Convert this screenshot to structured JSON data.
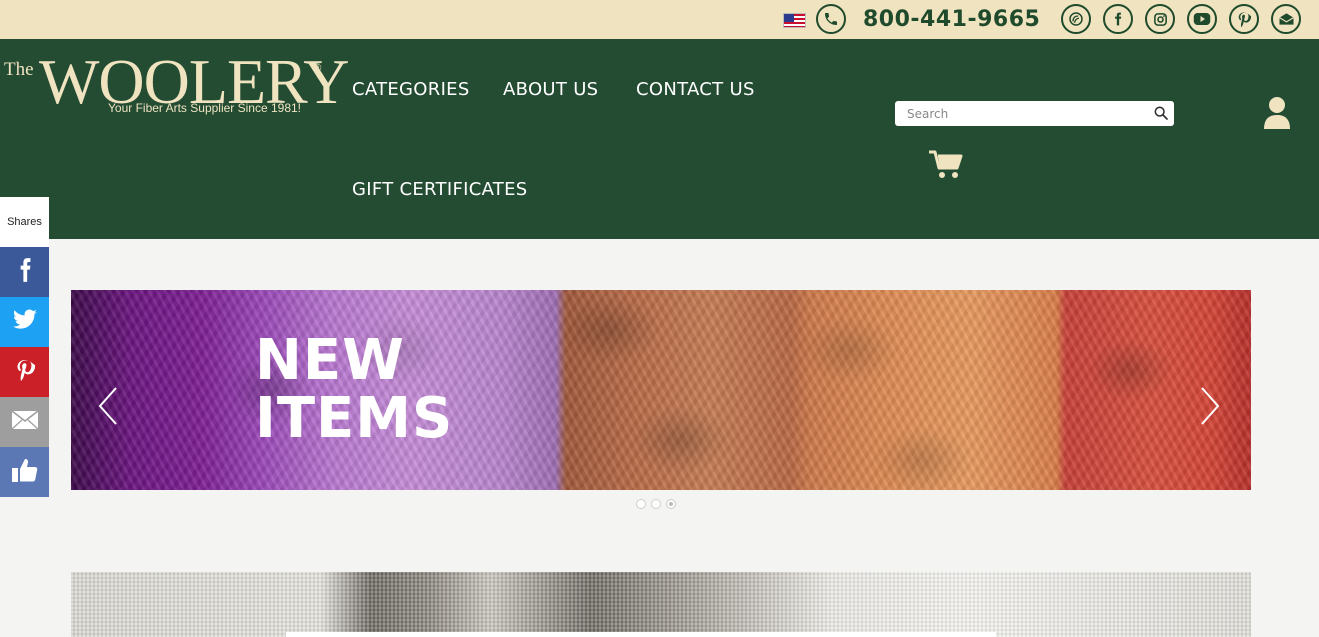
{
  "topbar": {
    "flag_icon": "us-flag-icon",
    "phone_number": "800-441-9665",
    "social_icons": [
      "ravelry-icon",
      "facebook-icon",
      "instagram-icon",
      "youtube-icon",
      "pinterest-icon",
      "email-icon"
    ],
    "background_color": "#efe3c0",
    "icon_color": "#1f4a2c"
  },
  "header": {
    "background_color": "#244c33",
    "logo": {
      "prefix": "The",
      "name": "WOOLERY",
      "registered": "®",
      "tagline": "Your Fiber Arts Supplier Since 1981!"
    },
    "nav": [
      {
        "label": "CATEGORIES"
      },
      {
        "label": "ABOUT US"
      },
      {
        "label": "CONTACT US"
      },
      {
        "label": "GIFT CERTIFICATES"
      }
    ],
    "search": {
      "placeholder": "Search",
      "value": ""
    },
    "cart_icon": "cart-icon",
    "account_icon": "user-icon"
  },
  "share_bar": {
    "label": "Shares",
    "buttons": [
      {
        "name": "facebook",
        "color": "#3b5998"
      },
      {
        "name": "twitter",
        "color": "#1da1f2"
      },
      {
        "name": "pinterest",
        "color": "#cb2027"
      },
      {
        "name": "email",
        "color": "#9e9e9e"
      },
      {
        "name": "like",
        "color": "#5b78b5"
      }
    ]
  },
  "slider": {
    "title": "NEW\nITEMS",
    "prev_icon": "chevron-left-icon",
    "next_icon": "chevron-right-icon",
    "slide_count": 3,
    "active_slide": 3
  }
}
